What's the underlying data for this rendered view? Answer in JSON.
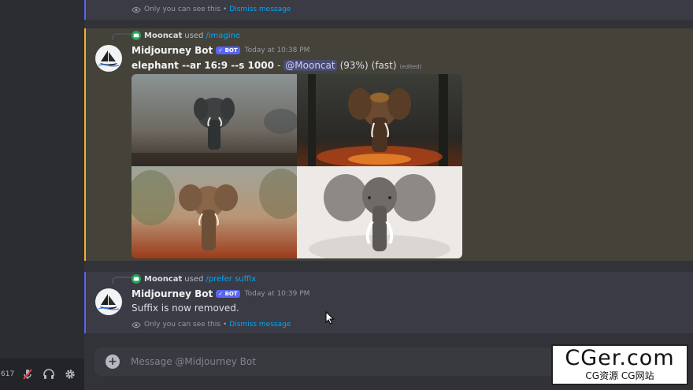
{
  "user_bar": {
    "user_tag": "617"
  },
  "ephemeral_top": {
    "notice": "Only you can see this",
    "separator": "•",
    "dismiss": "Dismiss message"
  },
  "message1": {
    "reply": {
      "user": "Mooncat",
      "used": "used",
      "command": "/imagine"
    },
    "author": "Midjourney Bot",
    "badge": "✓ BOT",
    "timestamp": "Today at 10:38 PM",
    "prompt": "elephant --ar 16:9 --s 1000",
    "dash": "-",
    "mention": "@Mooncat",
    "progress": "(93%)",
    "mode": "(fast)",
    "edited": "(edited)"
  },
  "message2": {
    "reply": {
      "user": "Mooncat",
      "used": "used",
      "command": "/prefer suffix"
    },
    "author": "Midjourney Bot",
    "badge": "✓ BOT",
    "timestamp": "Today at 10:39 PM",
    "text": "Suffix is now removed.",
    "notice": "Only you can see this",
    "separator": "•",
    "dismiss": "Dismiss message"
  },
  "composer": {
    "placeholder": "Message @Midjourney Bot"
  },
  "watermark": {
    "big": "CGer.com",
    "small": "CG资源 CG网站"
  },
  "icons": [
    "eye-icon",
    "discord-mini-avatar-icon",
    "midjourney-avatar-icon",
    "plus-icon",
    "mute-mic-icon",
    "headphones-icon",
    "gear-icon",
    "mouse-cursor-icon"
  ]
}
